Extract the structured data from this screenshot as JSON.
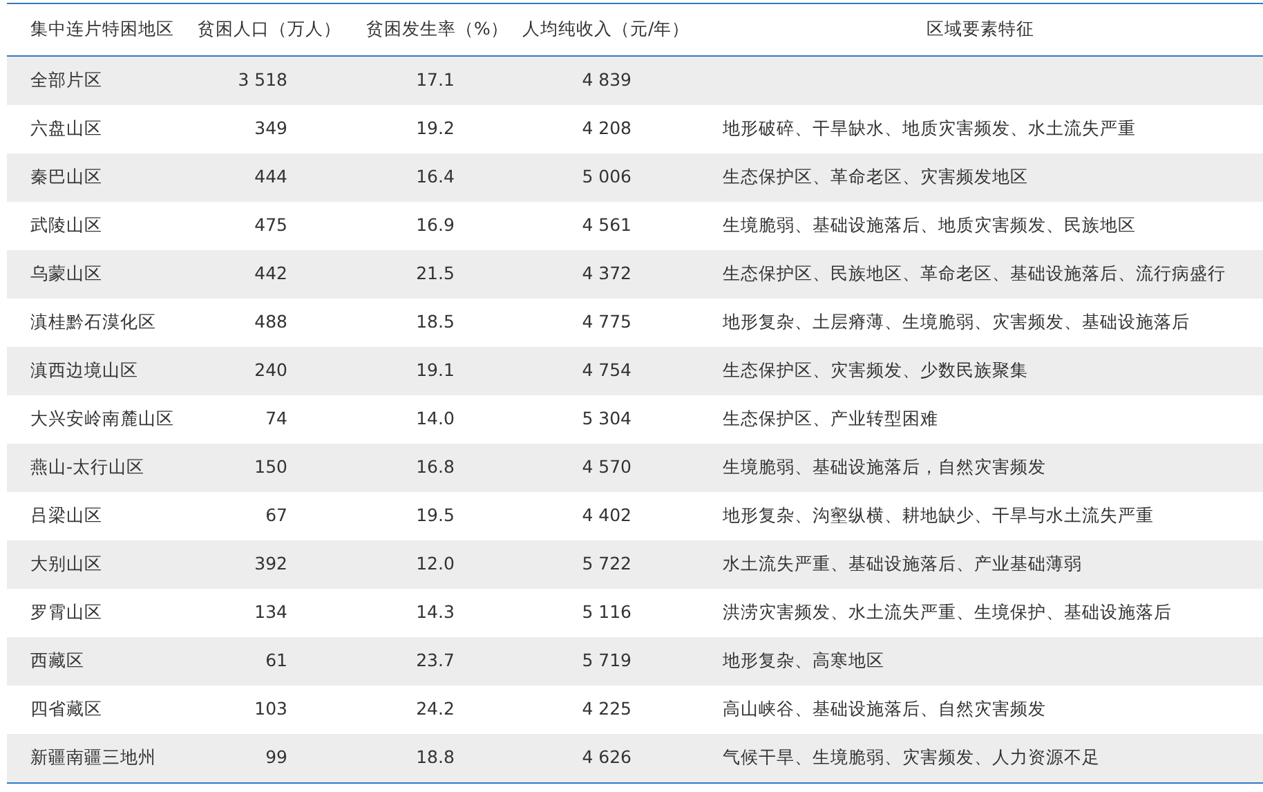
{
  "table": {
    "columns": [
      "集中连片特困地区",
      "贫困人口（万人）",
      "贫困发生率（%）",
      "人均纯收入（元/年）",
      "区域要素特征"
    ],
    "rows": [
      {
        "region": "全部片区",
        "population": "3 518",
        "rate": "17.1",
        "income": "4 839",
        "features": ""
      },
      {
        "region": "六盘山区",
        "population": "349",
        "rate": "19.2",
        "income": "4 208",
        "features": "地形破碎、干旱缺水、地质灾害频发、水土流失严重"
      },
      {
        "region": "秦巴山区",
        "population": "444",
        "rate": "16.4",
        "income": "5 006",
        "features": "生态保护区、革命老区、灾害频发地区"
      },
      {
        "region": "武陵山区",
        "population": "475",
        "rate": "16.9",
        "income": "4 561",
        "features": "生境脆弱、基础设施落后、地质灾害频发、民族地区"
      },
      {
        "region": "乌蒙山区",
        "population": "442",
        "rate": "21.5",
        "income": "4 372",
        "features": "生态保护区、民族地区、革命老区、基础设施落后、流行病盛行"
      },
      {
        "region": "滇桂黔石漠化区",
        "population": "488",
        "rate": "18.5",
        "income": "4 775",
        "features": "地形复杂、土层瘠薄、生境脆弱、灾害频发、基础设施落后"
      },
      {
        "region": "滇西边境山区",
        "population": "240",
        "rate": "19.1",
        "income": "4 754",
        "features": "生态保护区、灾害频发、少数民族聚集"
      },
      {
        "region": "大兴安岭南麓山区",
        "population": "74",
        "rate": "14.0",
        "income": "5 304",
        "features": "生态保护区、产业转型困难"
      },
      {
        "region": "燕山-太行山区",
        "population": "150",
        "rate": "16.8",
        "income": "4 570",
        "features": "生境脆弱、基础设施落后，自然灾害频发"
      },
      {
        "region": "吕梁山区",
        "population": "67",
        "rate": "19.5",
        "income": "4 402",
        "features": "地形复杂、沟壑纵横、耕地缺少、干旱与水土流失严重"
      },
      {
        "region": "大别山区",
        "population": "392",
        "rate": "12.0",
        "income": "5 722",
        "features": "水土流失严重、基础设施落后、产业基础薄弱"
      },
      {
        "region": "罗霄山区",
        "population": "134",
        "rate": "14.3",
        "income": "5 116",
        "features": "洪涝灾害频发、水土流失严重、生境保护、基础设施落后"
      },
      {
        "region": "西藏区",
        "population": "61",
        "rate": "23.7",
        "income": "5 719",
        "features": "地形复杂、高寒地区"
      },
      {
        "region": "四省藏区",
        "population": "103",
        "rate": "24.2",
        "income": "4 225",
        "features": "高山峡谷、基础设施落后、自然灾害频发"
      },
      {
        "region": "新疆南疆三地州",
        "population": "99",
        "rate": "18.8",
        "income": "4 626",
        "features": "气候干旱、生境脆弱、灾害频发、人力资源不足"
      }
    ]
  }
}
